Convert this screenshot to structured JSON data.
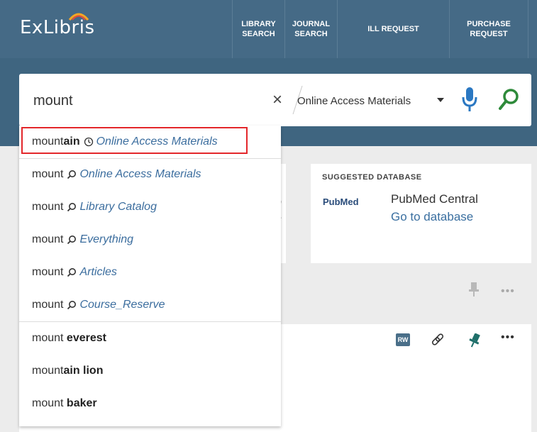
{
  "header": {
    "logo_text": "ExLibris",
    "nav": [
      {
        "label_line1": "LIBRARY",
        "label_line2": "SEARCH"
      },
      {
        "label_line1": "JOURNAL",
        "label_line2": "SEARCH"
      },
      {
        "label_line1": "ILL REQUEST",
        "label_line2": ""
      },
      {
        "label_line1": "PURCHASE",
        "label_line2": "REQUEST"
      }
    ]
  },
  "search": {
    "query": "mount",
    "clear_label": "×",
    "scope": "Online Access Materials"
  },
  "suggestions": {
    "history": [
      {
        "prefix": "mount",
        "completion": "ain",
        "scope": "Online Access Materials",
        "icon": "history-icon"
      }
    ],
    "scoped": [
      {
        "term": "mount",
        "scope": "Online Access Materials",
        "icon": "search-icon"
      },
      {
        "term": "mount",
        "scope": "Library Catalog",
        "icon": "search-icon"
      },
      {
        "term": "mount",
        "scope": "Everything",
        "icon": "search-icon"
      },
      {
        "term": "mount",
        "scope": "Articles",
        "icon": "search-icon"
      },
      {
        "term": "mount",
        "scope": "Course_Reserve",
        "icon": "search-icon"
      }
    ],
    "terms": [
      {
        "prefix": "mount",
        "completion": " everest"
      },
      {
        "prefix": "mount",
        "completion": "ain lion"
      },
      {
        "prefix": "mount",
        "completion": " baker"
      }
    ]
  },
  "suggested_database": {
    "title": "SUGGESTED DATABASE",
    "logo_text": "PubMed",
    "name": "PubMed Central",
    "link": "Go to database"
  },
  "card_peek": {
    "line1": "o",
    "line2": "e"
  },
  "result_actions": {
    "rw_label": "RW",
    "more_label": "•••"
  },
  "colors": {
    "header_bg": "#456a86",
    "band_bg": "#3f6580",
    "accent_blue": "#3b6d9e",
    "go_green": "#2e8a3a",
    "pin_teal": "#1f6f6a",
    "highlight_red": "#e3272b"
  }
}
